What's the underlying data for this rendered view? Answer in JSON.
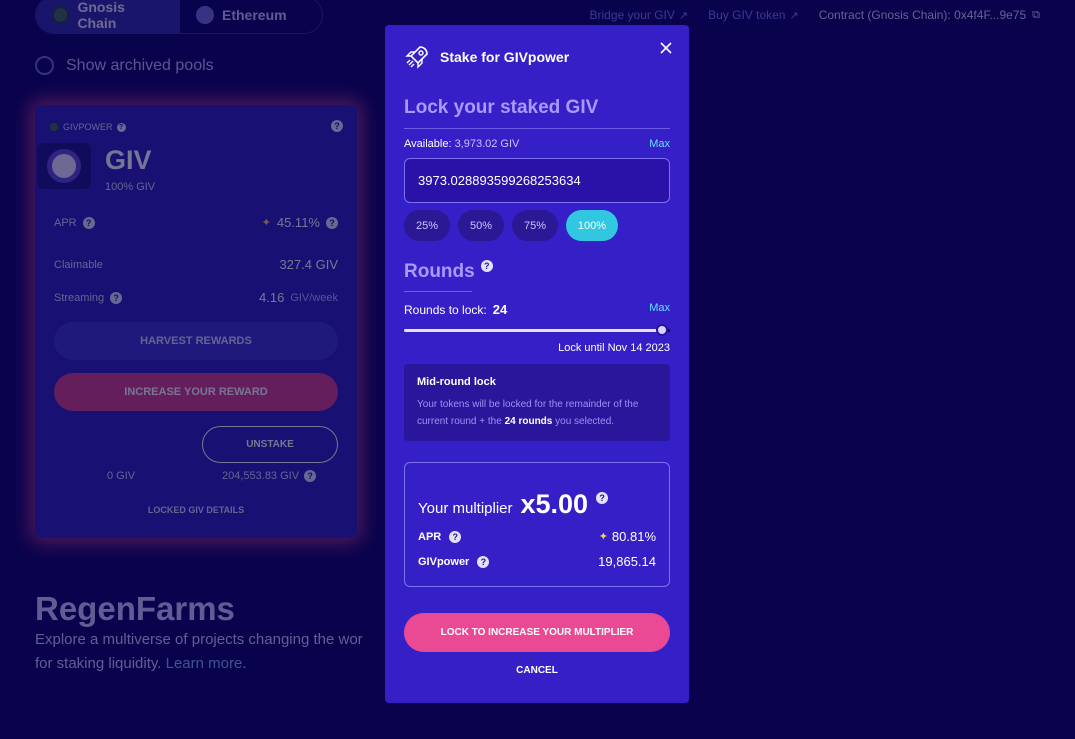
{
  "chain_switch": {
    "gnosis": "Gnosis Chain",
    "ethereum": "Ethereum"
  },
  "archived_label": "Show archived pools",
  "top_links": {
    "bridge": "Bridge your GIV",
    "buy": "Buy GIV token",
    "contract": "Contract (Gnosis Chain):  0x4f4F...9e75"
  },
  "pool_card": {
    "badge": "GIVPOWER",
    "title": "GIV",
    "subtitle": "100% GIV",
    "apr_label": "APR",
    "apr_value": "45.11%",
    "claimable_label": "Claimable",
    "claimable_value": "327.4 GIV",
    "streaming_label": "Streaming",
    "streaming_value": "4.16",
    "streaming_unit": "GIV/week",
    "harvest_label": "HARVEST REWARDS",
    "increase_label": "INCREASE YOUR REWARD",
    "unstake_label": "UNSTAKE",
    "locked_balance": "0 GIV",
    "staked_balance": "204,553.83 GIV",
    "details_label": "LOCKED GIV DETAILS"
  },
  "regen": {
    "title": "RegenFarms",
    "desc": "Explore a multiverse of projects changing the world and earn rewards for staking liquidity.",
    "desc_visible_1": "Explore a multiverse of projects changing the wor",
    "desc_visible_2": "for staking liquidity.",
    "learn_more": "Learn more",
    "period": "."
  },
  "modal": {
    "title": "Stake for GIVpower",
    "lock_title": "Lock your staked GIV",
    "available_label": "Available:",
    "available_value": "3,973.02 GIV",
    "max_label": "Max",
    "amount_value": "3973.028893599268253634",
    "percentages": [
      "25%",
      "50%",
      "75%",
      "100%"
    ],
    "rounds_title": "Rounds",
    "rounds_to_lock_label": "Rounds to lock:",
    "rounds_to_lock_value": "24",
    "rounds_fraction": 0.97,
    "lock_until": "Lock until Nov 14 2023",
    "midround_title": "Mid-round lock",
    "midround_desc_1": "Your tokens will be locked for the remainder of the current round + the",
    "midround_rounds": "24 rounds",
    "midround_desc_2": "you selected.",
    "multiplier_label": "Your multiplier",
    "multiplier_value": "x5.00",
    "apr_label": "APR",
    "apr_value": "80.81%",
    "givpower_label": "GIVpower",
    "givpower_value": "19,865.14",
    "lock_button": "LOCK TO INCREASE YOUR MULTIPLIER",
    "cancel_button": "CANCEL",
    "help_glyph": "?"
  },
  "colors": {
    "background": "#0a0262",
    "modal": "#3520c8",
    "accent_pink": "#e94a93",
    "accent_cyan": "#32c7e0"
  }
}
